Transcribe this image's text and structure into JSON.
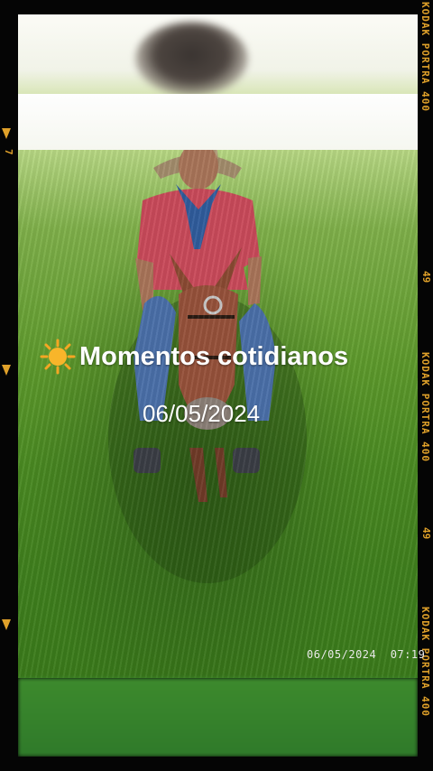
{
  "photo": {
    "subject": "man-on-mule-in-grass"
  },
  "overlay": {
    "icon": "sun-icon",
    "title": "Momentos cotidianos",
    "date": "06/05/2024",
    "timestamp": "06/05/2024  07:19"
  },
  "film_border": {
    "labels": [
      "KODAK PORTRA 400",
      "49",
      "KODAK PORTRA 400",
      "49",
      "KODAK PORTRA 400"
    ],
    "frame_number": "7",
    "accent_color": "#e0a12a"
  }
}
